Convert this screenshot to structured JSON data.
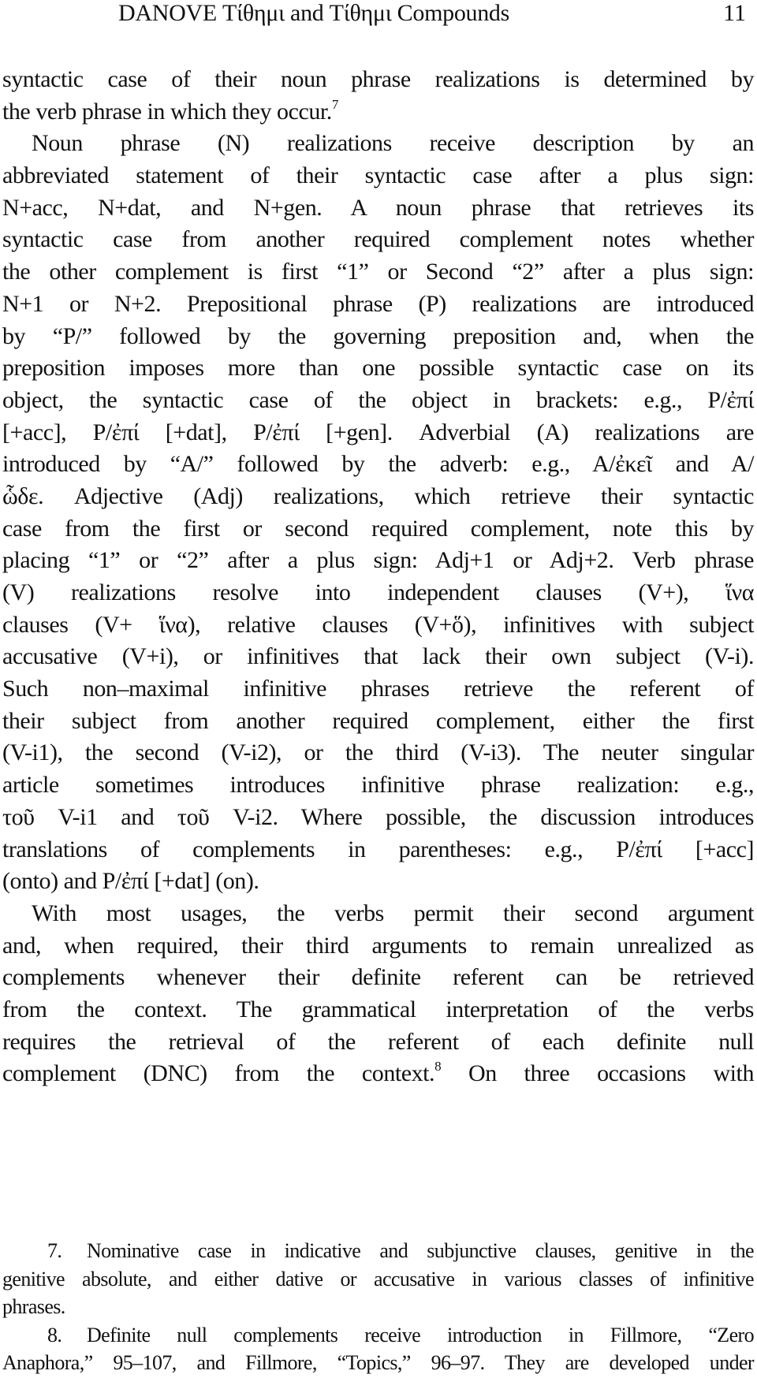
{
  "header": {
    "running_head": "DANOVE  Τίθημι and Τίθημι Compounds",
    "page_number": "11"
  },
  "body": {
    "lines": [
      {
        "text": "syntactic case of their noun phrase realizations is determined by",
        "indent": false,
        "last": false
      },
      {
        "text": "the verb phrase in which they occur.",
        "sup": "7",
        "indent": false,
        "last": true
      },
      {
        "text": "Noun phrase (N) realizations receive description by an",
        "indent": true,
        "last": false
      },
      {
        "text": "abbreviated statement of their syntactic case after a plus sign:",
        "indent": false,
        "last": false
      },
      {
        "text": "N+acc, N+dat, and N+gen. A noun phrase that retrieves its",
        "indent": false,
        "last": false
      },
      {
        "text": "syntactic case from another required complement notes whether",
        "indent": false,
        "last": false
      },
      {
        "text": "the other complement is first “1” or Second “2” after a plus sign:",
        "indent": false,
        "last": false
      },
      {
        "text": "N+1 or N+2. Prepositional phrase (P) realizations are introduced",
        "indent": false,
        "last": false
      },
      {
        "text": "by “P/” followed by the governing preposition and, when the",
        "indent": false,
        "last": false
      },
      {
        "text": "preposition imposes more than one possible syntactic case on its",
        "indent": false,
        "last": false
      },
      {
        "text": "object, the syntactic case of the object in brackets: e.g., P/ἐπί",
        "indent": false,
        "last": false
      },
      {
        "text": "[+acc], P/ἐπί [+dat], P/ἐπί [+gen]. Adverbial (A) realizations are",
        "indent": false,
        "last": false
      },
      {
        "text": "introduced by “A/” followed by the adverb: e.g., A/ἐκεῖ and A/",
        "indent": false,
        "last": false
      },
      {
        "text": "ὧδε. Adjective (Adj) realizations, which retrieve their syntactic",
        "indent": false,
        "last": false
      },
      {
        "text": "case from the first or second required complement, note this by",
        "indent": false,
        "last": false
      },
      {
        "text": "placing “1” or “2” after a plus sign: Adj+1 or Adj+2. Verb phrase",
        "indent": false,
        "last": false
      },
      {
        "text": "(V) realizations resolve into independent clauses (V+), ἵνα",
        "indent": false,
        "last": false
      },
      {
        "text": "clauses (V+ ἵνα), relative clauses (V+ὅ), infinitives with subject",
        "indent": false,
        "last": false
      },
      {
        "text": "accusative (V+i), or infinitives that lack their own subject (V-i).",
        "indent": false,
        "last": false
      },
      {
        "text": "Such non–maximal infinitive phrases retrieve the referent of",
        "indent": false,
        "last": false
      },
      {
        "text": "their subject from another required complement, either the first",
        "indent": false,
        "last": false
      },
      {
        "text": "(V-i1), the second (V-i2), or the third (V-i3). The neuter singular",
        "indent": false,
        "last": false
      },
      {
        "text": "article sometimes introduces infinitive phrase realization: e.g.,",
        "indent": false,
        "last": false
      },
      {
        "text": "τοῦ V-i1 and τοῦ V-i2. Where possible, the discussion introduces",
        "indent": false,
        "last": false
      },
      {
        "text": "translations of complements in parentheses: e.g., P/ἐπί [+acc]",
        "indent": false,
        "last": false
      },
      {
        "text": "(onto) and P/ἐπί [+dat] (on).",
        "indent": false,
        "last": true
      },
      {
        "text": "With most usages, the verbs permit their second argument",
        "indent": true,
        "last": false
      },
      {
        "text": "and, when required, their third arguments to remain unrealized as",
        "indent": false,
        "last": false
      },
      {
        "text": "complements whenever their definite referent can be retrieved",
        "indent": false,
        "last": false
      },
      {
        "text": "from the context. The grammatical interpretation of the verbs",
        "indent": false,
        "last": false
      },
      {
        "text": "requires the retrieval of the referent of each definite null",
        "indent": false,
        "last": false
      },
      {
        "text": "complement (DNC) from the context.",
        "sup": "8",
        "tail": " On three occasions with",
        "indent": false,
        "last": false
      }
    ]
  },
  "footnotes": {
    "lines": [
      {
        "num": "7.",
        "text": "Nominative case in indicative and subjunctive clauses, genitive in the",
        "indent": true,
        "last": false
      },
      {
        "text": "genitive absolute, and either dative or accusative in various classes of infinitive",
        "indent": false,
        "last": false
      },
      {
        "text": "phrases.",
        "indent": false,
        "last": true
      },
      {
        "num": "8.",
        "text": "Definite null complements receive introduction in Fillmore, “Zero",
        "indent": true,
        "last": false
      },
      {
        "text": "Anaphora,” 95–107, and Fillmore, “Topics,” 96–97. They are developed under",
        "indent": false,
        "last": false
      }
    ]
  }
}
